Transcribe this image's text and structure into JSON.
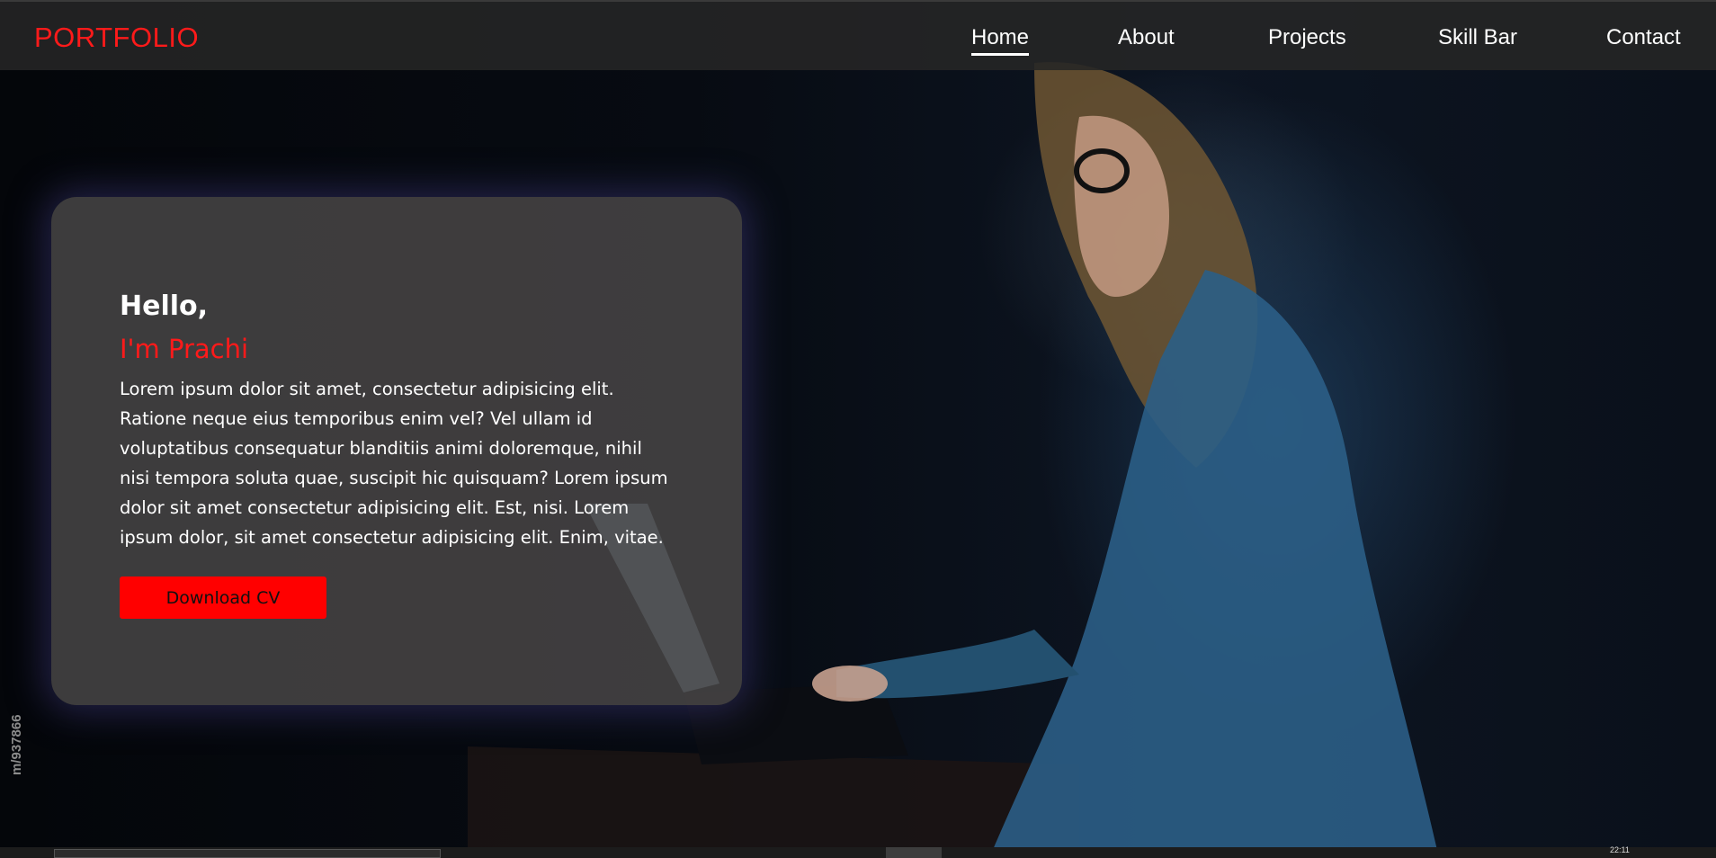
{
  "navbar": {
    "brand": "PORTFOLIO",
    "links": [
      "Home",
      "About",
      "Projects",
      "Skill Bar",
      "Contact"
    ],
    "active_link": "Home"
  },
  "hero": {
    "greeting": "Hello,",
    "name_line": "I'm Prachi",
    "bio": "Lorem ipsum dolor sit amet, consectetur adipisicing elit. Ratione neque eius temporibus enim vel? Vel ullam id voluptatibus consequatur blanditiis animi doloremque, nihil nisi tempora soluta quae, suscipit hic quisquam? Lorem ipsum dolor sit amet consectetur adipisicing elit. Est, nisi. Lorem ipsum dolor, sit amet consectetur adipisicing elit. Enim, vitae.",
    "cta_label": "Download CV"
  },
  "watermark": {
    "image_id_text": "m/937866"
  },
  "taskbar": {
    "clock": "22:11"
  },
  "colors": {
    "accent": "#ff0000",
    "nav_bg": "#262626",
    "card_bg": "#4a4848",
    "text": "#ffffff"
  }
}
